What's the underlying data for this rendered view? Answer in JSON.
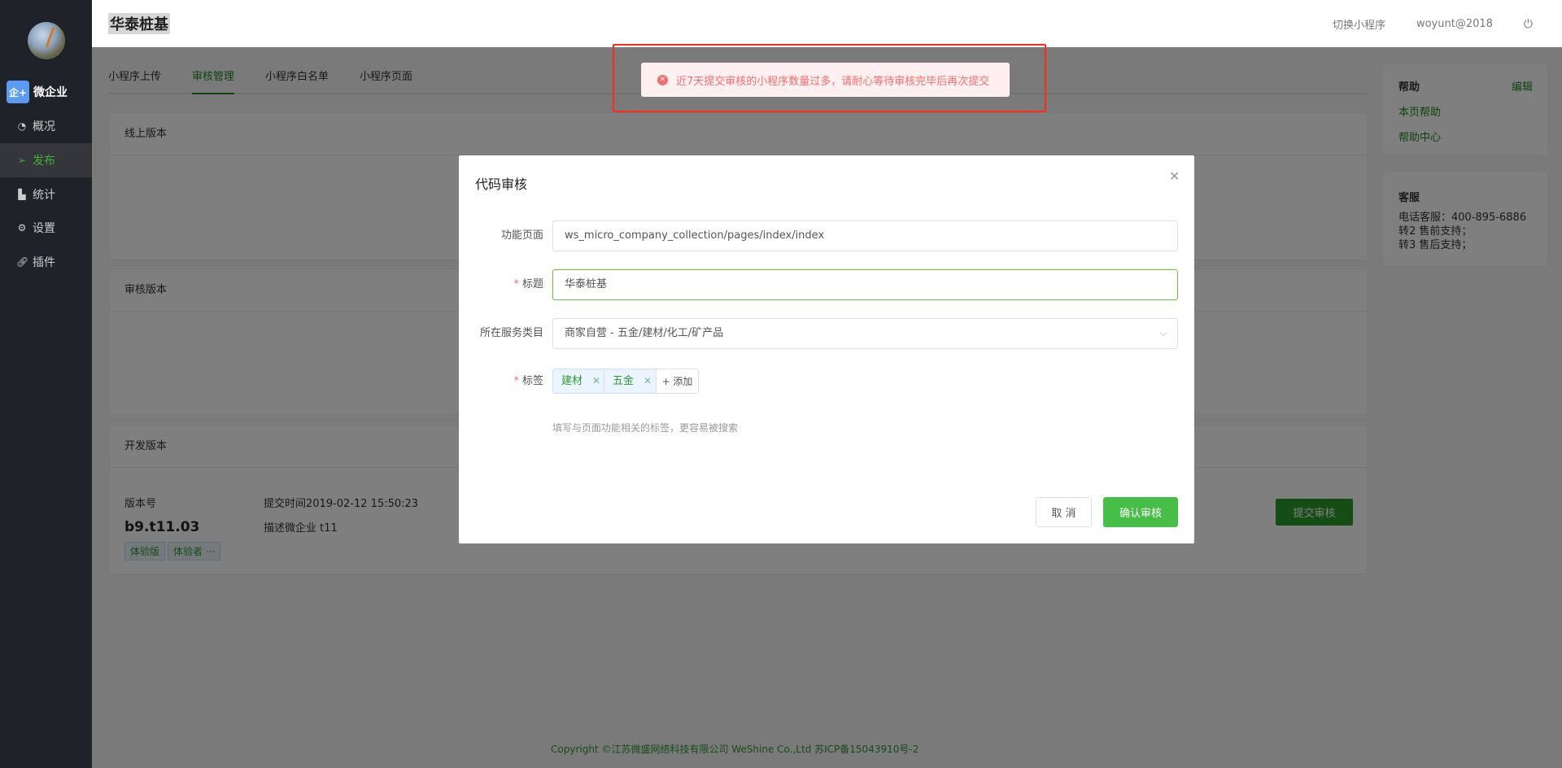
{
  "sidebar": {
    "logo": "微企业",
    "logo_icon": "企+",
    "items": [
      {
        "label": "概况",
        "icon": "dashboard-icon"
      },
      {
        "label": "发布",
        "icon": "send-icon"
      },
      {
        "label": "统计",
        "icon": "chart-icon"
      },
      {
        "label": "设置",
        "icon": "gear-icon"
      },
      {
        "label": "插件",
        "icon": "link-icon"
      }
    ]
  },
  "header": {
    "title": "华泰桩基",
    "switch": "切换小程序",
    "user": "woyunt@2018"
  },
  "tabs": [
    "小程序上传",
    "审核管理",
    "小程序白名单",
    "小程序页面"
  ],
  "cards": {
    "online": "线上版本",
    "review": "审核版本",
    "dev": "开发版本"
  },
  "dev": {
    "version_label": "版本号",
    "version": "b9.t11.03",
    "submit_time": "提交时间2019-02-12 15:50:23",
    "desc": "描述微企业 t11",
    "badge1": "体验版",
    "badge2": "体验者 ···",
    "submit_btn": "提交审核"
  },
  "help": {
    "title": "帮助",
    "edit": "编辑",
    "link1": "本页帮助",
    "link2": "帮助中心"
  },
  "service": {
    "title": "客服",
    "line1": "电话客服：400-895-6886",
    "line2": "转2 售前支持；",
    "line3": "转3 售后支持；"
  },
  "footer": "Copyright ©江苏微盛网络科技有限公司 WeShine Co.,Ltd 苏ICP备15043910号-2",
  "modal": {
    "title": "代码审核",
    "page_label": "功能页面",
    "page_value": "ws_micro_company_collection/pages/index/index",
    "title_label": "标题",
    "title_value": "华泰桩基",
    "category_label": "所在服务类目",
    "category_value": "商家自营 - 五金/建材/化工/矿产品",
    "tags_label": "标签",
    "tags": [
      "建材",
      "五金"
    ],
    "add_tag": "+ 添加",
    "hint": "填写与页面功能相关的标签，更容易被搜索",
    "cancel": "取 消",
    "confirm": "确认审核"
  },
  "toast": {
    "message": "近7天提交审核的小程序数量过多，请耐心等待审核完毕后再次提交"
  },
  "colors": {
    "accent": "#47be47",
    "error": "#f56c6c",
    "sidebar": "#20222a"
  }
}
